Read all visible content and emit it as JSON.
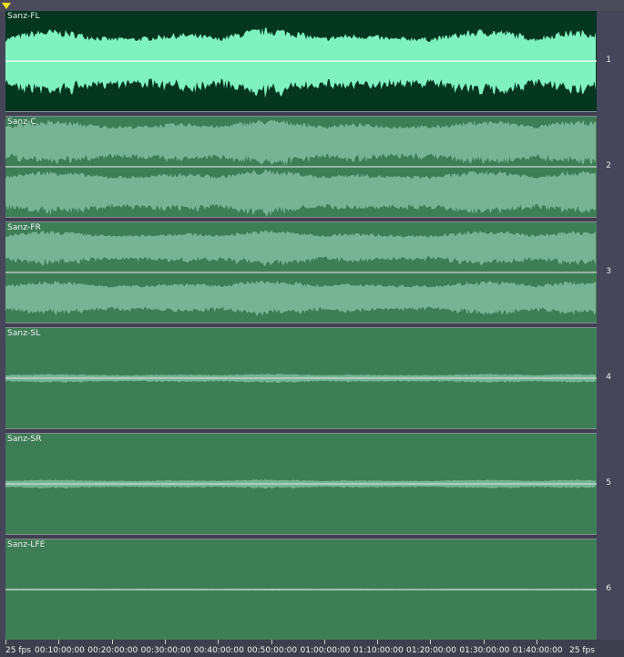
{
  "tracks": [
    {
      "name": "Sanz-FL",
      "number": "1",
      "stereo_split": false,
      "wave_level": 0.75,
      "bg": "#043620",
      "wave": "#7ff2c0",
      "envelope": "#ffffff"
    },
    {
      "name": "Sanz-C",
      "number": "2",
      "stereo_split": true,
      "wave_level": 0.9,
      "bg": "#3e7e56",
      "wave": "#76b494",
      "envelope": "#d0d8d4"
    },
    {
      "name": "Sanz-FR",
      "number": "3",
      "stereo_split": true,
      "wave_level": 0.7,
      "bg": "#3e7e56",
      "wave": "#76b494",
      "envelope": "#d0d8d4"
    },
    {
      "name": "Sanz-SL",
      "number": "4",
      "stereo_split": false,
      "wave_level": 0.1,
      "bg": "#3e7e56",
      "wave": "#76b494",
      "envelope": "#d0d8d4"
    },
    {
      "name": "Sanz-SR",
      "number": "5",
      "stereo_split": false,
      "wave_level": 0.1,
      "bg": "#3e7e56",
      "wave": "#76b494",
      "envelope": "#d0d8d4"
    },
    {
      "name": "Sanz-LFE",
      "number": "6",
      "stereo_split": false,
      "wave_level": 0.02,
      "bg": "#3e7e56",
      "wave": "#76b494",
      "envelope": "#d0d8d4"
    }
  ],
  "timeline": {
    "labels": [
      "25 fps",
      "00:10:00:00",
      "00:20:00:00",
      "00:30:00:00",
      "00:40:00:00",
      "00:50:00:00",
      "01:00:00:00",
      "01:10:00:00",
      "01:20:00:00",
      "01:30:00:00",
      "01:40:00:00",
      "25 fps"
    ]
  },
  "playhead_color": "#f3e21b"
}
